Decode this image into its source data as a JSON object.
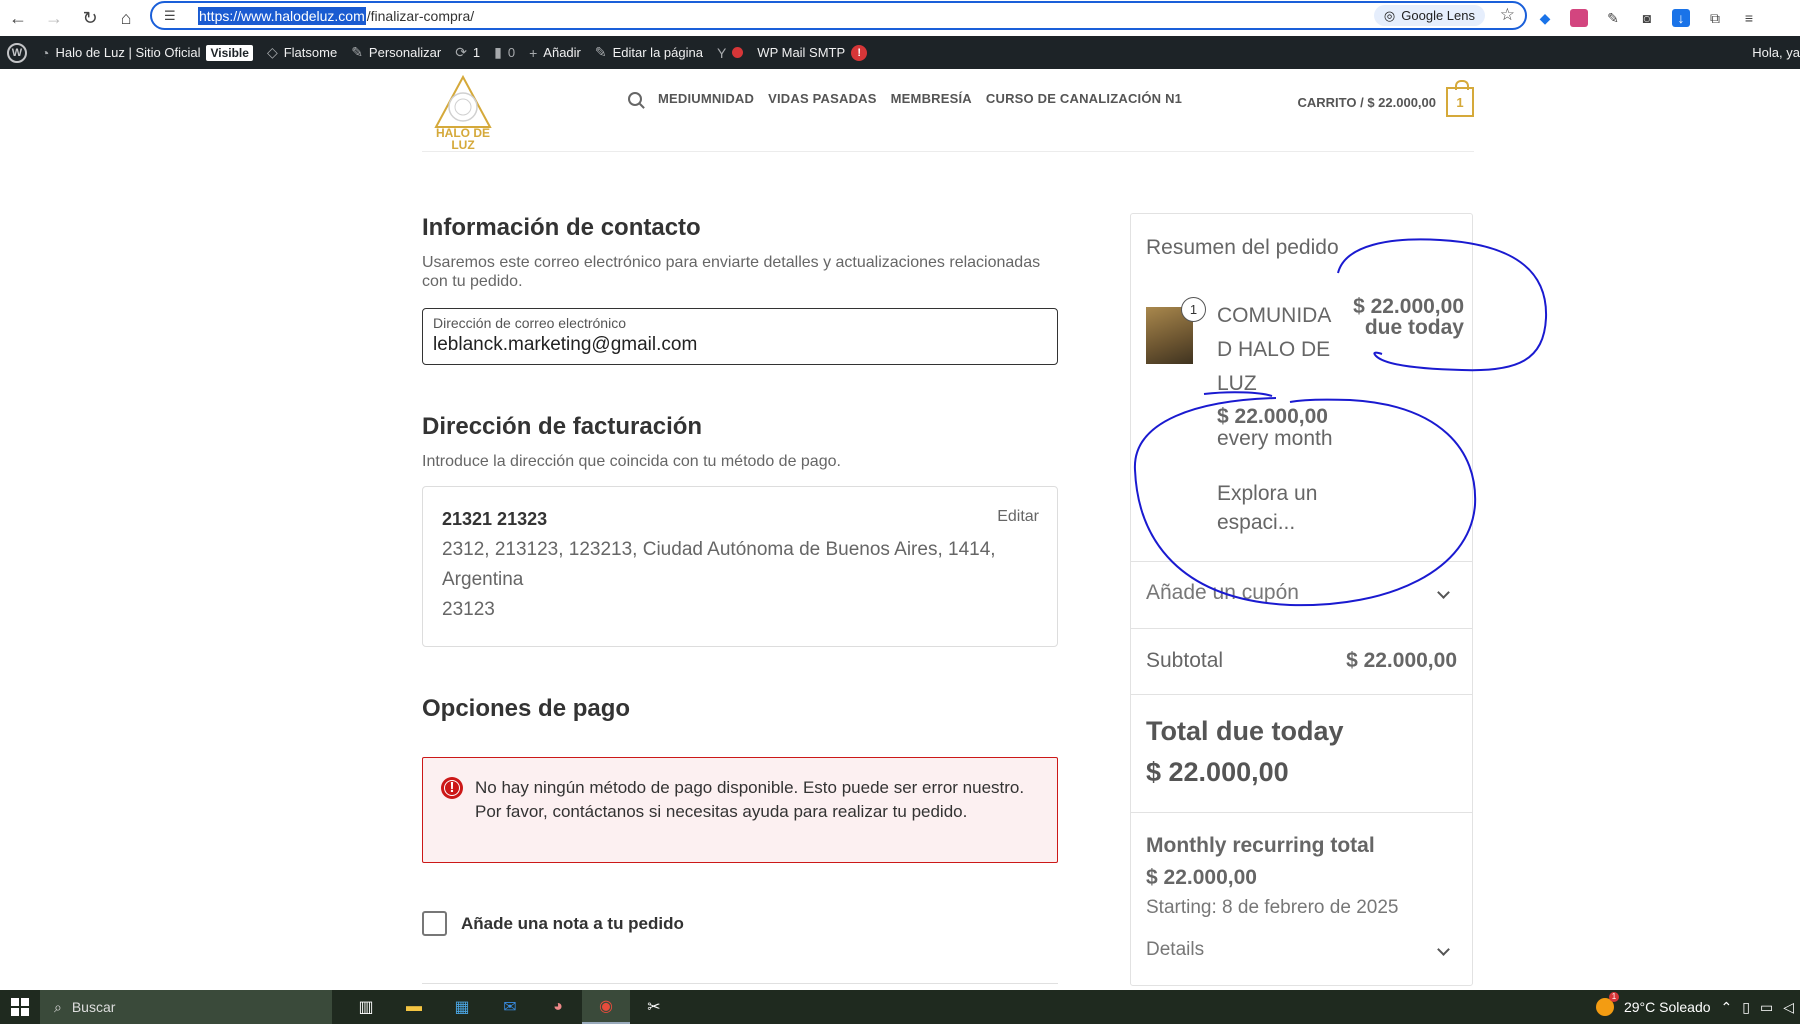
{
  "browser": {
    "url_highlight": "https://www.halodeluz.com",
    "url_rest": "/finalizar-compra/",
    "lens_label": "Google Lens"
  },
  "adminbar": {
    "site_name": "Halo de Luz | Sitio Oficial",
    "visible_badge": "Visible",
    "theme": "Flatsome",
    "customize": "Personalizar",
    "updates_count": "1",
    "comments_count": "0",
    "add_new": "Añadir",
    "edit_page": "Editar la página",
    "mail_smtp": "WP Mail SMTP",
    "smtp_alert": "!",
    "greeting": "Hola, ya"
  },
  "header": {
    "logo_text": "HALO DE LUZ",
    "nav": [
      "MEDIUMNIDAD",
      "VIDAS PASADAS",
      "MEMBRESÍA",
      "CURSO DE CANALIZACIÓN N1"
    ],
    "cart_label": "CARRITO / $ 22.000,00",
    "cart_count": "1"
  },
  "contact": {
    "title": "Información de contacto",
    "description": "Usaremos este correo electrónico para enviarte detalles y actualizaciones relacionadas con tu pedido.",
    "email_label": "Dirección de correo electrónico",
    "email_value": "leblanck.marketing@gmail.com"
  },
  "billing": {
    "title": "Dirección de facturación",
    "description": "Introduce la dirección que coincida con tu método de pago.",
    "name": "21321 21323",
    "line1": "2312, 213123, 123213, Ciudad Autónoma de Buenos Aires, 1414, Argentina",
    "line2": "23123",
    "edit_label": "Editar"
  },
  "payment": {
    "title": "Opciones de pago",
    "error": "No hay ningún método de pago disponible. Esto puede ser error nuestro. Por favor, contáctanos si necesitas ayuda para realizar tu pedido."
  },
  "note": {
    "label": "Añade una nota a tu pedido"
  },
  "summary": {
    "title": "Resumen del pedido",
    "product": {
      "quantity": "1",
      "name": "COMUNIDAD HALO DE LUZ",
      "price": "$ 22.000,00",
      "price_note": "due today",
      "recurring_amount": "$ 22.000,00",
      "recurring_period": "every month",
      "description": "Explora un espaci..."
    },
    "coupon_label": "Añade un cupón",
    "subtotal_label": "Subtotal",
    "subtotal_value": "$ 22.000,00",
    "total_label": "Total due today",
    "total_value": "$ 22.000,00",
    "recurring_label": "Monthly recurring total",
    "recurring_value": "$ 22.000,00",
    "recurring_start": "Starting: 8 de febrero de 2025",
    "details_label": "Details"
  },
  "taskbar": {
    "search_placeholder": "Buscar",
    "weather": "29°C  Soleado"
  },
  "colors": {
    "accent_gold": "#d5a93a",
    "error_red": "#cc1818",
    "annotation_blue": "#1a1ad0",
    "adminbar_bg": "#1d2327"
  }
}
